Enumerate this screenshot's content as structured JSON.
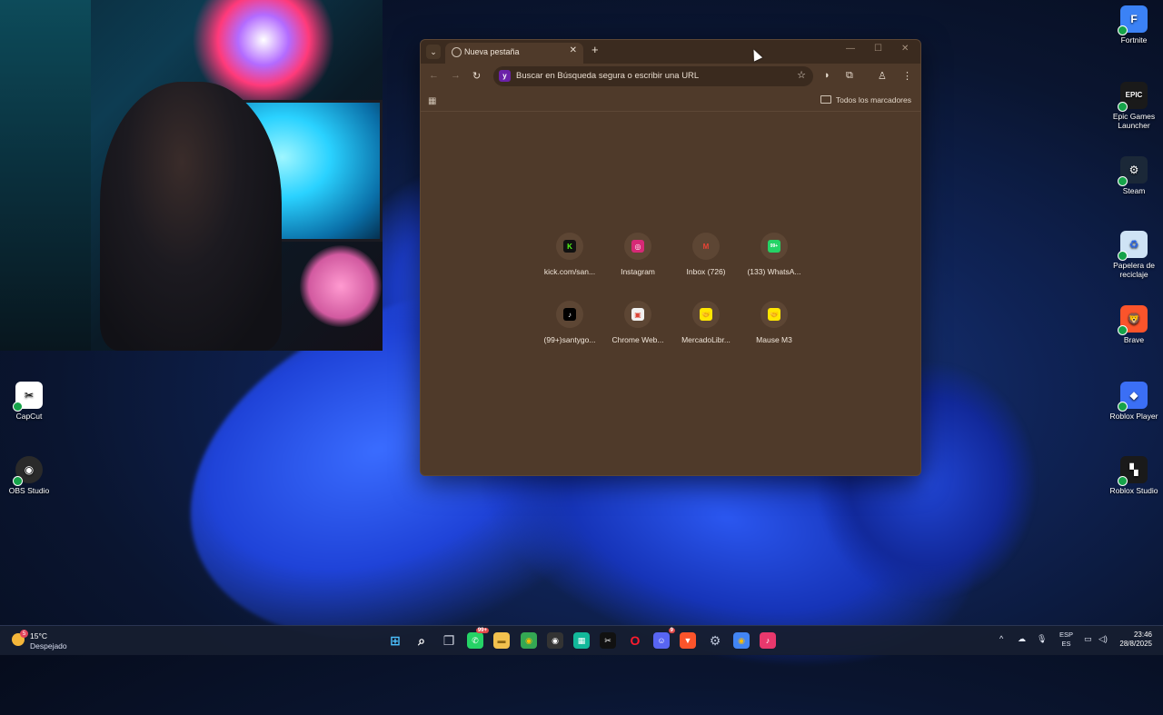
{
  "desktop": {
    "left_icons": [
      {
        "label": "CapCut",
        "icon": "capcut-icon",
        "glyph": "✂",
        "color": "#ffffff",
        "fg": "#000000"
      },
      {
        "label": "OBS Studio",
        "icon": "obs-icon",
        "glyph": "◉",
        "color": "#2a2a2a",
        "fg": "#ffffff"
      }
    ],
    "right_icons": [
      {
        "label": "Fortnite",
        "icon": "fortnite-icon",
        "glyph": "F",
        "color": "#3b82f6",
        "fg": "#ffffff"
      },
      {
        "label": "Epic Games Launcher",
        "icon": "epic-games-icon",
        "glyph": "EPIC",
        "color": "#1a1a1a",
        "fg": "#ffffff"
      },
      {
        "label": "Steam",
        "icon": "steam-icon",
        "glyph": "⚙",
        "color": "#1b2838",
        "fg": "#ffffff"
      },
      {
        "label": "Papelera de reciclaje",
        "icon": "recycle-bin-icon",
        "glyph": "♻",
        "color": "#cfe3f5",
        "fg": "#2563eb"
      },
      {
        "label": "Brave",
        "icon": "brave-icon",
        "glyph": "🦁",
        "color": "#fb542b",
        "fg": "#ffffff"
      },
      {
        "label": "Roblox Player",
        "icon": "roblox-player-icon",
        "glyph": "◆",
        "color": "#3b6ff5",
        "fg": "#ffffff"
      },
      {
        "label": "Roblox Studio",
        "icon": "roblox-studio-icon",
        "glyph": "▚",
        "color": "#1a1a1a",
        "fg": "#ffffff"
      }
    ]
  },
  "browser": {
    "tab_title": "Nueva pestaña",
    "omnibox_placeholder": "Buscar en Búsqueda segura o escribir una URL",
    "bookmarks_all": "Todos los marcadores",
    "shortcuts": [
      {
        "label": "kick.com/san...",
        "icon": "kick-icon",
        "glyph": "K",
        "bg": "#111111",
        "fg": "#53fc18"
      },
      {
        "label": "Instagram",
        "icon": "instagram-icon",
        "glyph": "◎",
        "bg": "#d62976",
        "fg": "#ffffff"
      },
      {
        "label": "Inbox (726)",
        "icon": "gmail-icon",
        "glyph": "M",
        "bg": "#5d4634",
        "fg": "#ea4335"
      },
      {
        "label": "(133) WhatsA...",
        "icon": "whatsapp-icon",
        "glyph": "99+",
        "bg": "#25d366",
        "fg": "#ffffff"
      },
      {
        "label": "(99+)santygo...",
        "icon": "tiktok-icon",
        "glyph": "♪",
        "bg": "#000000",
        "fg": "#ffffff"
      },
      {
        "label": "Chrome Web...",
        "icon": "chrome-web-store-icon",
        "glyph": "▣",
        "bg": "#f1f1f1",
        "fg": "#db4437"
      },
      {
        "label": "MercadoLibr...",
        "icon": "mercadolibre-icon",
        "glyph": "🤝",
        "bg": "#ffe600",
        "fg": "#2d3277"
      },
      {
        "label": "Mause M3",
        "icon": "mercadolibre-icon",
        "glyph": "🤝",
        "bg": "#ffe600",
        "fg": "#2d3277"
      }
    ]
  },
  "taskbar": {
    "weather_temp": "15°C",
    "weather_desc": "Despejado",
    "weather_badge": "5",
    "apps": [
      {
        "name": "start-button",
        "glyph": "⊞",
        "bg": "transparent",
        "fg": "#4cc2ff"
      },
      {
        "name": "search-icon",
        "glyph": "⌕",
        "bg": "transparent",
        "fg": "#ffffff"
      },
      {
        "name": "task-view-icon",
        "glyph": "❐",
        "bg": "transparent",
        "fg": "#d0d4e0"
      },
      {
        "name": "whatsapp-taskbar-icon",
        "glyph": "✆",
        "bg": "#25d366",
        "fg": "#ffffff",
        "badge": "99+"
      },
      {
        "name": "file-explorer-icon",
        "glyph": "▬",
        "bg": "#f2c14e",
        "fg": "#8a6412"
      },
      {
        "name": "chrome-taskbar-icon",
        "glyph": "◉",
        "bg": "#34a853",
        "fg": "#fbbc05"
      },
      {
        "name": "obs-taskbar-icon",
        "glyph": "◉",
        "bg": "#333333",
        "fg": "#ffffff"
      },
      {
        "name": "app-taskbar-icon",
        "glyph": "▦",
        "bg": "#12b89a",
        "fg": "#ffffff"
      },
      {
        "name": "capcut-taskbar-icon",
        "glyph": "✂",
        "bg": "#111111",
        "fg": "#ffffff"
      },
      {
        "name": "opera-taskbar-icon",
        "glyph": "O",
        "bg": "transparent",
        "fg": "#ff1b2d"
      },
      {
        "name": "discord-taskbar-icon",
        "glyph": "☺",
        "bg": "#5865f2",
        "fg": "#ffffff",
        "badge": "9"
      },
      {
        "name": "brave-taskbar-icon",
        "glyph": "▼",
        "bg": "#fb542b",
        "fg": "#ffffff"
      },
      {
        "name": "settings-taskbar-icon",
        "glyph": "⚙",
        "bg": "transparent",
        "fg": "#b9c2d6"
      },
      {
        "name": "chrome-canary-taskbar-icon",
        "glyph": "◉",
        "bg": "#4285f4",
        "fg": "#fbbc05"
      },
      {
        "name": "tiktok-taskbar-icon",
        "glyph": "♪",
        "bg": "#e8386d",
        "fg": "#ffffff"
      }
    ],
    "tray": {
      "chevron": "^",
      "cloud": "☁",
      "mic": "🎙"
    },
    "lang_1": "ESP",
    "lang_2": "ES",
    "time": "23:46",
    "date": "28/8/2025"
  }
}
